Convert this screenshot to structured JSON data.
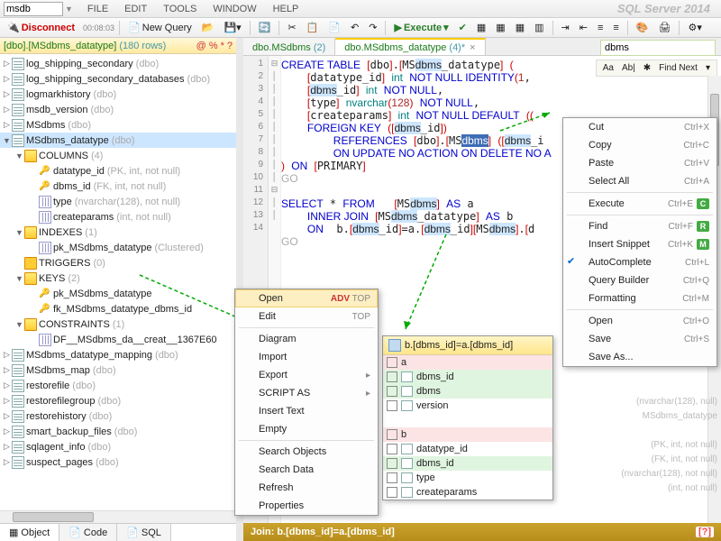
{
  "header": {
    "database": "msdb",
    "menus": [
      "FILE",
      "EDIT",
      "TOOLS",
      "WINDOW",
      "HELP"
    ],
    "app_title": "SQL Server 2014"
  },
  "toolbar": {
    "disconnect": "Disconnect",
    "new_query": "New Query",
    "execute": "Execute",
    "clock": "00:08:03"
  },
  "sidebar": {
    "tab_title": "[dbo].[MSdbms_datatype]",
    "tab_count": "(180 rows)",
    "flags": [
      "@",
      "%",
      "*",
      "?"
    ],
    "items": [
      {
        "label": "log_shipping_secondary",
        "meta": "(dbo)",
        "icon": "table",
        "ind": 0,
        "ar": "▷"
      },
      {
        "label": "log_shipping_secondary_databases",
        "meta": "(dbo)",
        "icon": "table",
        "ind": 0,
        "ar": "▷"
      },
      {
        "label": "logmarkhistory",
        "meta": "(dbo)",
        "icon": "table",
        "ind": 0,
        "ar": "▷"
      },
      {
        "label": "msdb_version",
        "meta": "(dbo)",
        "icon": "table",
        "ind": 0,
        "ar": "▷"
      },
      {
        "label": "MSdbms",
        "meta": "(dbo)",
        "icon": "table",
        "ind": 0,
        "ar": "▷"
      },
      {
        "label": "MSdbms_datatype",
        "meta": "(dbo)",
        "icon": "table",
        "ind": 0,
        "ar": "▼",
        "sel": true
      },
      {
        "label": "COLUMNS",
        "meta": "(4)",
        "icon": "folder-open",
        "ind": 1,
        "ar": "▼"
      },
      {
        "label": "datatype_id",
        "meta": "(PK, int, not null)",
        "icon": "key",
        "ind": 2
      },
      {
        "label": "dbms_id",
        "meta": "(FK, int, not null)",
        "icon": "key",
        "ind": 2
      },
      {
        "label": "type",
        "meta": "(nvarchar(128), not null)",
        "icon": "col",
        "ind": 2
      },
      {
        "label": "createparams",
        "meta": "(int, not null)",
        "icon": "col",
        "ind": 2
      },
      {
        "label": "INDEXES",
        "meta": "(1)",
        "icon": "folder-open",
        "ind": 1,
        "ar": "▼"
      },
      {
        "label": "pk_MSdbms_datatype",
        "meta": "(Clustered)",
        "icon": "col",
        "ind": 2
      },
      {
        "label": "TRIGGERS",
        "meta": "(0)",
        "icon": "folder",
        "ind": 1
      },
      {
        "label": "KEYS",
        "meta": "(2)",
        "icon": "folder-open",
        "ind": 1,
        "ar": "▼"
      },
      {
        "label": "pk_MSdbms_datatype",
        "meta": "",
        "icon": "key",
        "ind": 2
      },
      {
        "label": "fk_MSdbms_datatype_dbms_id",
        "meta": "",
        "icon": "key",
        "ind": 2
      },
      {
        "label": "CONSTRAINTS",
        "meta": "(1)",
        "icon": "folder-open",
        "ind": 1,
        "ar": "▼"
      },
      {
        "label": "DF__MSdbms_da__creat__1367E60",
        "meta": "",
        "icon": "col",
        "ind": 2
      },
      {
        "label": "MSdbms_datatype_mapping",
        "meta": "(dbo)",
        "icon": "table",
        "ind": 0,
        "ar": "▷"
      },
      {
        "label": "MSdbms_map",
        "meta": "(dbo)",
        "icon": "table",
        "ind": 0,
        "ar": "▷"
      },
      {
        "label": "restorefile",
        "meta": "(dbo)",
        "icon": "table",
        "ind": 0,
        "ar": "▷"
      },
      {
        "label": "restorefilegroup",
        "meta": "(dbo)",
        "icon": "table",
        "ind": 0,
        "ar": "▷"
      },
      {
        "label": "restorehistory",
        "meta": "(dbo)",
        "icon": "table",
        "ind": 0,
        "ar": "▷"
      },
      {
        "label": "smart_backup_files",
        "meta": "(dbo)",
        "icon": "table",
        "ind": 0,
        "ar": "▷"
      },
      {
        "label": "sqlagent_info",
        "meta": "(dbo)",
        "icon": "table",
        "ind": 0,
        "ar": "▷"
      },
      {
        "label": "suspect_pages",
        "meta": "(dbo)",
        "icon": "table",
        "ind": 0,
        "ar": "▷"
      }
    ],
    "bottom_tabs": [
      "Object",
      "Code",
      "SQL"
    ]
  },
  "editor": {
    "tabs": [
      {
        "label": "dbo.MSdbms",
        "count": "(2)",
        "active": false
      },
      {
        "label": "dbo.MSdbms_datatype",
        "count": "(4)*",
        "active": true
      }
    ],
    "find_value": "dbms",
    "find_toolbar": [
      "Aa",
      "Ab|",
      "✱",
      "Find Next",
      "▾"
    ],
    "line_count": 14,
    "status": "Join: b.[dbms_id]=a.[dbms_id]"
  },
  "intel": {
    "header": "b.[dbms_id]=a.[dbms_id]",
    "rows": [
      {
        "label": "a",
        "cls": "red",
        "chk": true
      },
      {
        "label": "dbms_id",
        "cls": "grn",
        "icon": true,
        "chk": true
      },
      {
        "label": "dbms",
        "cls": "grn",
        "icon": true,
        "chk": true
      },
      {
        "label": "version",
        "cls": "",
        "icon": true,
        "chk": true,
        "hint": "(nvarchar(128), null)"
      },
      {
        "label": "",
        "cls": "",
        "hint": "MSdbms_datatype"
      },
      {
        "label": "b",
        "cls": "red",
        "chk": true
      },
      {
        "label": "datatype_id",
        "cls": "",
        "icon": true,
        "chk": true,
        "hint": "(PK, int, not null)"
      },
      {
        "label": "dbms_id",
        "cls": "grn",
        "icon": true,
        "chk": true,
        "hint": "(FK, int, not null)"
      },
      {
        "label": "type",
        "cls": "",
        "icon": true,
        "chk": true,
        "hint": "(nvarchar(128), not null)"
      },
      {
        "label": "createparams",
        "cls": "",
        "icon": true,
        "chk": true,
        "hint": "(int, not null)"
      }
    ]
  },
  "ctx_left": [
    {
      "label": "Open",
      "right": "ADV TOP",
      "hov": true
    },
    {
      "label": "Edit",
      "right": "TOP"
    },
    {
      "sep": true
    },
    {
      "label": "Diagram"
    },
    {
      "label": "Import"
    },
    {
      "label": "Export",
      "arrow": true
    },
    {
      "label": "SCRIPT AS",
      "arrow": true
    },
    {
      "label": "Insert Text"
    },
    {
      "label": "Empty"
    },
    {
      "sep": true
    },
    {
      "label": "Search Objects"
    },
    {
      "label": "Search Data"
    },
    {
      "label": "Refresh"
    },
    {
      "label": "Properties"
    }
  ],
  "ctx_right": [
    {
      "label": "Cut",
      "right": "Ctrl+X"
    },
    {
      "label": "Copy",
      "right": "Ctrl+C"
    },
    {
      "label": "Paste",
      "right": "Ctrl+V"
    },
    {
      "label": "Select All",
      "right": "Ctrl+A"
    },
    {
      "sep": true
    },
    {
      "label": "Execute",
      "right": "Ctrl+E",
      "badge": "C",
      "bcolor": "#4a4"
    },
    {
      "sep": true
    },
    {
      "label": "Find",
      "right": "Ctrl+F",
      "badge": "R",
      "bcolor": "#4a4"
    },
    {
      "label": "Insert Snippet",
      "right": "Ctrl+K",
      "badge": "M",
      "bcolor": "#4a4"
    },
    {
      "label": "AutoComplete",
      "right": "Ctrl+L",
      "check": true
    },
    {
      "label": "Query Builder",
      "right": "Ctrl+Q"
    },
    {
      "label": "Formatting",
      "right": "Ctrl+M"
    },
    {
      "sep": true
    },
    {
      "label": "Open",
      "right": "Ctrl+O"
    },
    {
      "label": "Save",
      "right": "Ctrl+S"
    },
    {
      "label": "Save As..."
    }
  ]
}
